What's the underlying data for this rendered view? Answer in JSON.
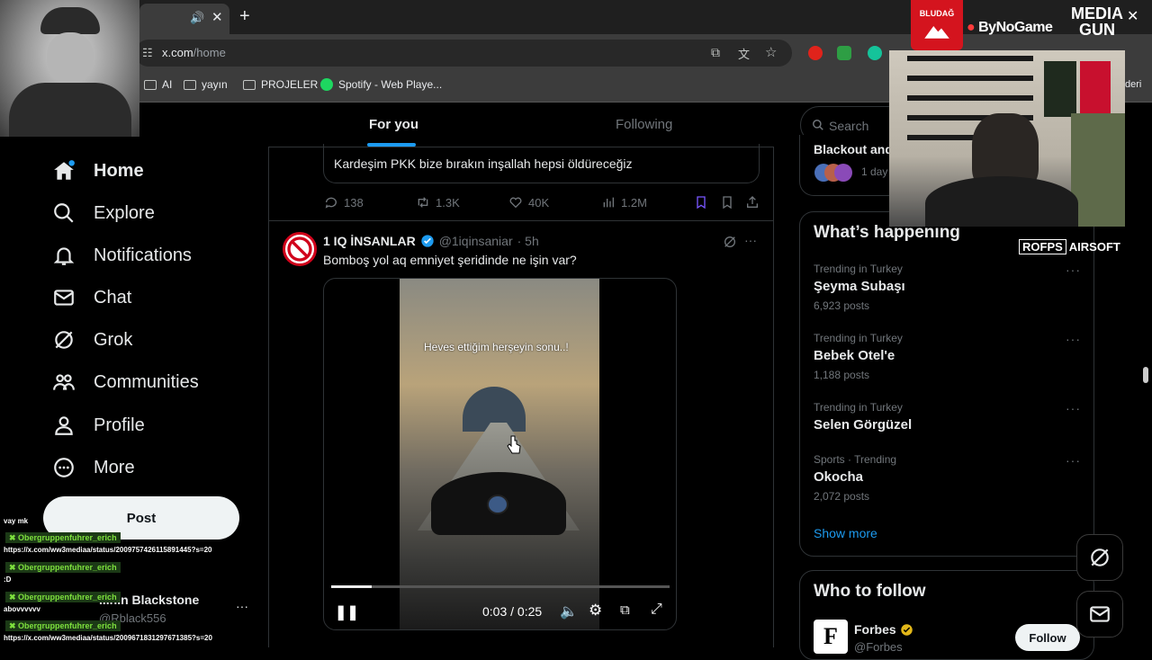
{
  "browser": {
    "url_domain": "x.com",
    "url_path": "/home",
    "bookmarks": [
      {
        "label": "AI",
        "icon": "folder-icon"
      },
      {
        "label": "yayın",
        "icon": "folder-icon"
      },
      {
        "label": "PROJELER",
        "icon": "folder-icon"
      },
      {
        "label": "Spotify - Web Playe...",
        "icon": "spotify-icon"
      }
    ],
    "right_bookmark_fragment": "deri"
  },
  "nav": {
    "items": [
      {
        "label": "Home",
        "icon": "home-icon"
      },
      {
        "label": "Explore",
        "icon": "search-icon"
      },
      {
        "label": "Notifications",
        "icon": "bell-icon"
      },
      {
        "label": "Chat",
        "icon": "envelope-icon"
      },
      {
        "label": "Grok",
        "icon": "grok-icon"
      },
      {
        "label": "Communities",
        "icon": "communities-icon"
      },
      {
        "label": "Profile",
        "icon": "person-icon"
      },
      {
        "label": "More",
        "icon": "more-circle-icon"
      }
    ],
    "post_label": "Post",
    "account_name": "...nin Blackstone",
    "account_handle": "@Rblack556"
  },
  "feed": {
    "tabs": [
      {
        "label": "For you",
        "active": true
      },
      {
        "label": "Following",
        "active": false
      }
    ],
    "prev_quote_text": "Kardeşim PKK bize bırakın inşallah hepsi  öldüreceğiz",
    "prev_actions": {
      "replies": "138",
      "reposts": "1.3K",
      "likes": "40K",
      "views": "1.2M"
    },
    "post": {
      "author": "1 IQ İNSANLAR",
      "handle": "@1iqinsaniar",
      "time": "· 5h",
      "text": "Bomboş yol aq emniyet şeridinde ne işin var?",
      "video_caption": "Heves ettiğim herşeyin sonu..!",
      "video_time": "0:03 / 0:25",
      "video_progress": 0.12
    }
  },
  "right": {
    "search_placeholder": "Search",
    "top_fragment_title": "Blackout and",
    "top_fragment_time": "1 day",
    "whats_happening_title": "What’s happening",
    "trends": [
      {
        "meta": "Trending in Turkey",
        "name": "Şeyma Subaşı",
        "count": "6,923 posts"
      },
      {
        "meta": "Trending in Turkey",
        "name": "Bebek Otel'e",
        "count": "1,188 posts"
      },
      {
        "meta": "Trending in Turkey",
        "name": "Selen Görgüzel",
        "count": ""
      },
      {
        "meta": "Sports · Trending",
        "name": "Okocha",
        "count": "2,072 posts"
      }
    ],
    "show_more": "Show more",
    "who_to_follow_title": "Who to follow",
    "follow_suggestion": {
      "name": "Forbes",
      "handle": "@Forbes",
      "button": "Follow",
      "avatar_letter": "F"
    }
  },
  "overlays": {
    "logo1": "BLUDAĞ",
    "logo2": "ByNoGame",
    "logo3_line1": "MEDIA",
    "logo3_line2": "GUN",
    "rofps": "ROFPS",
    "airsoft": "AIRSOFT",
    "chat": [
      {
        "user": "",
        "msg": "vay mk"
      },
      {
        "user": "Obergruppenfuhrer_erich",
        "msg": "https://x.com/ww3mediaa/status/2009757426115891445?s=20"
      },
      {
        "user": "Obergruppenfuhrer_erich",
        "msg": ":D"
      },
      {
        "user": "Obergruppenfuhrer_erich",
        "msg": "abovvvvvv"
      },
      {
        "user": "Obergruppenfuhrer_erich",
        "msg": "https://x.com/ww3mediaa/status/2009671831297671385?s=20"
      }
    ]
  }
}
